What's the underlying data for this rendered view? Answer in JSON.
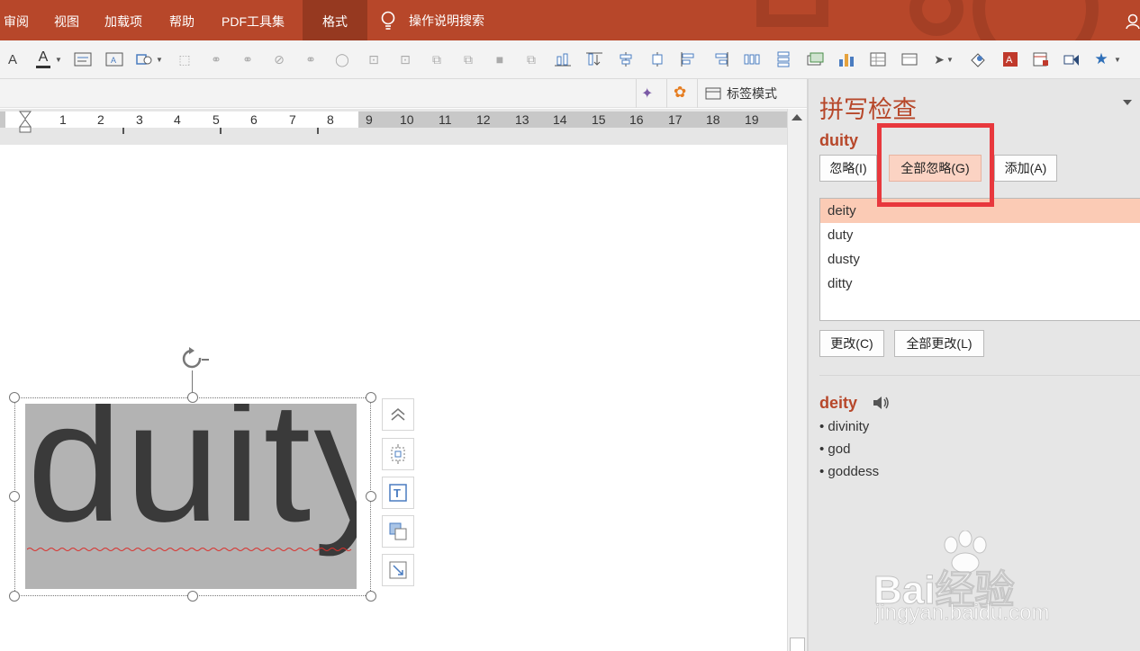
{
  "ribbon": {
    "tabs": [
      "审阅",
      "视图",
      "加载项",
      "帮助",
      "PDF工具集",
      "格式"
    ],
    "active_tab": "格式",
    "tell_me": "操作说明搜索"
  },
  "subbar": {
    "tag_mode": "标签模式"
  },
  "ruler": {
    "labels": [
      "1",
      "2",
      "3",
      "4",
      "5",
      "6",
      "7",
      "8",
      "9",
      "10",
      "11",
      "12",
      "13",
      "14",
      "15",
      "16",
      "17",
      "18",
      "19"
    ]
  },
  "slide": {
    "shape_text": "duity"
  },
  "pane": {
    "title": "拼写检查",
    "misspelled_word": "duity",
    "buttons": {
      "ignore": "忽略(I)",
      "ignore_all": "全部忽略(G)",
      "add": "添加(A)",
      "change": "更改(C)",
      "change_all": "全部更改(L)"
    },
    "suggestions": [
      "deity",
      "duty",
      "dusty",
      "ditty"
    ],
    "selected_suggestion": "deity",
    "dictionary": {
      "word": "deity",
      "synonyms": [
        "• divinity",
        "• god",
        "• goddess"
      ]
    }
  },
  "watermark": {
    "brand": "Bai经验",
    "url": "jingyan.baidu.com"
  },
  "colors": {
    "accent": "#b7472a",
    "highlight": "#fbcbb5",
    "annotation": "#e8383d"
  }
}
